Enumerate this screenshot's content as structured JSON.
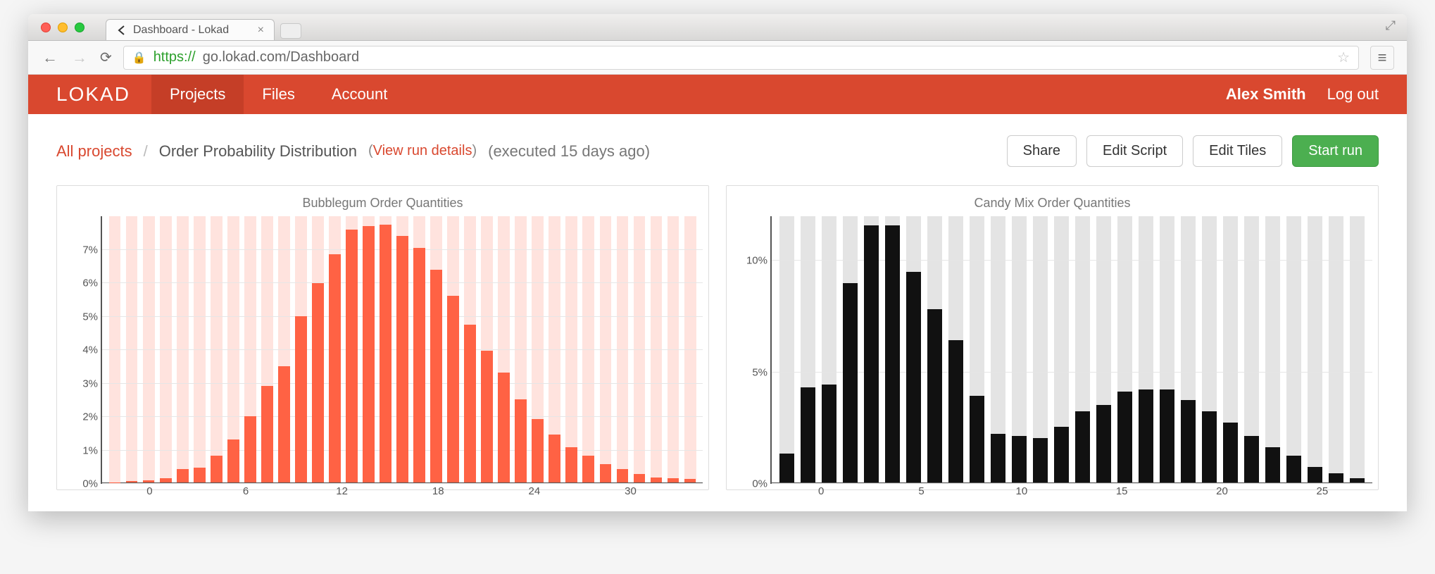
{
  "browser": {
    "tab_title": "Dashboard - Lokad",
    "url_https": "https://",
    "url_rest": "go.lokad.com/Dashboard"
  },
  "header": {
    "brand": "LOKAD",
    "nav": {
      "projects": "Projects",
      "files": "Files",
      "account": "Account"
    },
    "user": "Alex Smith",
    "logout": "Log out"
  },
  "breadcrumb": {
    "root": "All projects",
    "sep": "/",
    "current": "Order Probability Distribution",
    "view_run": "View run details",
    "executed": "(executed 15 days ago)"
  },
  "buttons": {
    "share": "Share",
    "edit_script": "Edit Script",
    "edit_tiles": "Edit Tiles",
    "start_run": "Start run"
  },
  "colors": {
    "brand_red": "#d9482f",
    "chart_orange": "#ff6244",
    "chart_orange_bg": "#ffe3de",
    "chart_black": "#111111",
    "chart_grey_bg": "#e4e4e4",
    "btn_green": "#4caf50"
  },
  "chart_data": [
    {
      "type": "bar",
      "title": "Bubblegum Order Quantities",
      "xlabel": "",
      "ylabel": "",
      "ylim": [
        0,
        8
      ],
      "x_ticks": [
        0,
        6,
        12,
        18,
        24,
        30
      ],
      "y_ticks_pct": [
        0,
        1,
        2,
        3,
        4,
        5,
        6,
        7
      ],
      "x": [
        0,
        1,
        2,
        3,
        4,
        5,
        6,
        7,
        8,
        9,
        10,
        11,
        12,
        13,
        14,
        15,
        16,
        17,
        18,
        19,
        20,
        21,
        22,
        23,
        24,
        25,
        26,
        27,
        28,
        29,
        30,
        31,
        32,
        33,
        34
      ],
      "values_pct": [
        0.01,
        0.05,
        0.07,
        0.12,
        0.4,
        0.45,
        0.8,
        1.3,
        2.0,
        2.9,
        3.5,
        5.0,
        6.0,
        6.85,
        7.6,
        7.7,
        7.75,
        7.4,
        7.05,
        6.4,
        5.6,
        4.75,
        3.95,
        3.3,
        2.5,
        1.9,
        1.45,
        1.05,
        0.8,
        0.55,
        0.4,
        0.25,
        0.15,
        0.12,
        0.1
      ],
      "bar_color_key": "chart_orange",
      "bar_bg_key": "chart_orange_bg"
    },
    {
      "type": "bar",
      "title": "Candy Mix Order Quantities",
      "xlabel": "",
      "ylabel": "",
      "ylim": [
        0,
        12
      ],
      "x_ticks": [
        0,
        5,
        10,
        15,
        20,
        25
      ],
      "y_ticks_pct": [
        0,
        5,
        10
      ],
      "x": [
        0,
        1,
        2,
        3,
        4,
        5,
        6,
        7,
        8,
        9,
        10,
        11,
        12,
        13,
        14,
        15,
        16,
        17,
        18,
        19,
        20,
        21,
        22,
        23,
        24,
        25,
        26,
        27
      ],
      "values_pct": [
        1.3,
        4.3,
        4.4,
        9.0,
        11.6,
        11.6,
        9.5,
        7.8,
        6.4,
        3.9,
        2.2,
        2.1,
        2.0,
        2.5,
        3.2,
        3.5,
        4.1,
        4.2,
        4.2,
        3.7,
        3.2,
        2.7,
        2.1,
        1.6,
        1.2,
        0.7,
        0.4,
        0.2
      ],
      "bar_color_key": "chart_black",
      "bar_bg_key": "chart_grey_bg"
    }
  ]
}
